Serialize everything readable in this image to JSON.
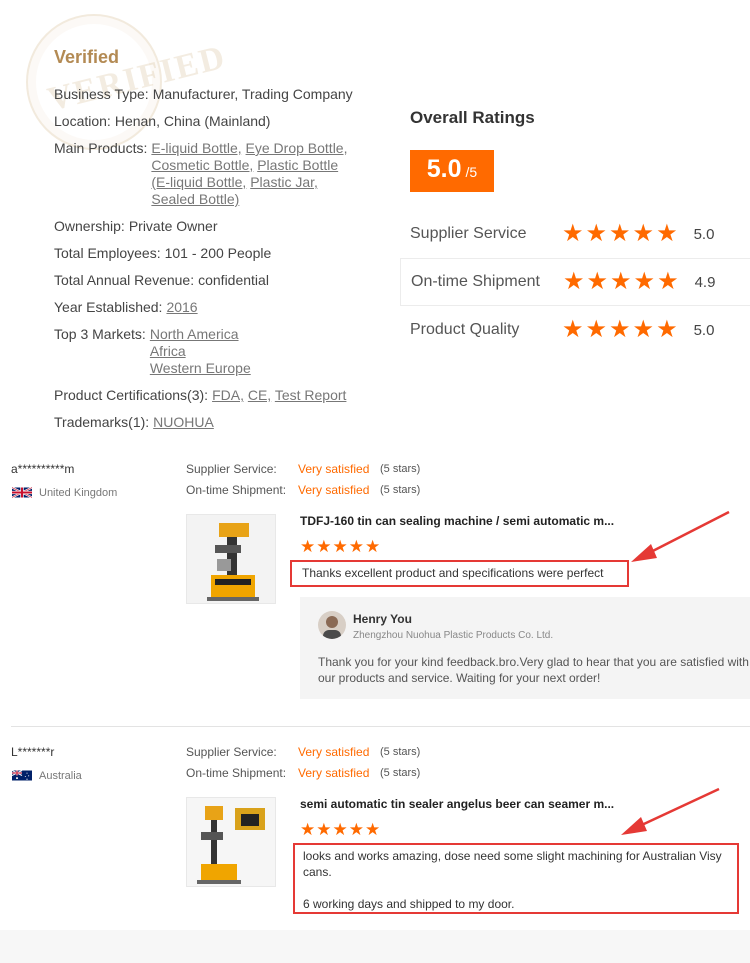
{
  "company": {
    "verified_label": "Verified",
    "stamp_text": "VERIFIED",
    "business_type": {
      "label": "Business Type:",
      "value": "Manufacturer, Trading Company"
    },
    "location": {
      "label": "Location:",
      "value": "Henan, China (Mainland)"
    },
    "main_products": {
      "label": "Main Products:",
      "links": [
        "E-liquid Bottle,",
        "Eye Drop Bottle,",
        "Cosmetic Bottle,",
        "Plastic Bottle (E-liquid Bottle,",
        "Plastic Jar,",
        "Sealed Bottle)"
      ]
    },
    "ownership": {
      "label": "Ownership:",
      "value": "Private Owner"
    },
    "employees": {
      "label": "Total Employees:",
      "value": "101 - 200 People"
    },
    "revenue": {
      "label": "Total Annual Revenue:",
      "value": "confidential"
    },
    "year": {
      "label": "Year Established:",
      "value": "2016"
    },
    "markets": {
      "label": "Top 3 Markets:",
      "values": [
        "North America",
        "Africa",
        "Western Europe"
      ]
    },
    "certifications": {
      "label": "Product Certifications(3):",
      "values": [
        "FDA,",
        "CE,",
        "Test Report"
      ]
    },
    "trademarks": {
      "label": "Trademarks(1):",
      "value": "NUOHUA"
    }
  },
  "ratings": {
    "title": "Overall Ratings",
    "score": "5.0",
    "score_denominator": "/5",
    "accent_color": "#ff6a00",
    "items": [
      {
        "label": "Supplier Service",
        "value": "5.0",
        "stars": 5
      },
      {
        "label": "On-time Shipment",
        "value": "4.9",
        "stars": 5
      },
      {
        "label": "Product Quality",
        "value": "5.0",
        "stars": 5
      }
    ]
  },
  "reviews": [
    {
      "buyer": "a**********m",
      "country": "United Kingdom",
      "supplier_service": {
        "label": "Supplier Service:",
        "value": "Very satisfied",
        "stars": "(5 stars)"
      },
      "shipment": {
        "label": "On-time Shipment:",
        "value": "Very satisfied",
        "stars": "(5 stars)"
      },
      "product_title": "TDFJ-160 tin can sealing machine / semi automatic m...",
      "rating_stars": 5,
      "comment": "Thanks excellent product and specifications were perfect",
      "reply": {
        "name": "Henry You",
        "company": "Zhengzhou Nuohua Plastic Products Co. Ltd.",
        "text": "Thank you for your kind feedback.bro.Very glad to hear that you are satisfied with our products and service. Waiting for your next order!"
      }
    },
    {
      "buyer": "L*******r",
      "country": "Australia",
      "supplier_service": {
        "label": "Supplier Service:",
        "value": "Very satisfied",
        "stars": "(5 stars)"
      },
      "shipment": {
        "label": "On-time Shipment:",
        "value": "Very satisfied",
        "stars": "(5 stars)"
      },
      "product_title": "semi automatic tin sealer angelus beer can seamer m...",
      "rating_stars": 5,
      "comment_line1": "looks and works amazing, dose need some slight machining for Australian Visy cans.",
      "comment_line2": "6 working days and shipped to my door."
    }
  ],
  "icons": {
    "star": "star-icon",
    "arrow": "red-arrow-annotation",
    "flag_uk": "uk-flag-icon",
    "flag_au": "australia-flag-icon"
  }
}
